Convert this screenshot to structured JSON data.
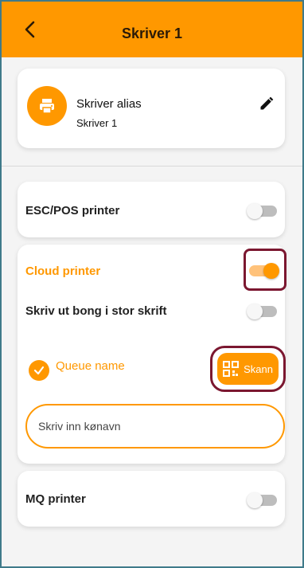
{
  "header": {
    "title": "Skriver 1",
    "back_icon": "chevron-left-icon"
  },
  "alias": {
    "icon": "printer-icon",
    "label": "Skriver alias",
    "value": "Skriver 1",
    "edit_icon": "pencil-icon"
  },
  "escpos": {
    "label": "ESC/POS printer",
    "enabled": false
  },
  "cloud": {
    "label": "Cloud printer",
    "enabled": true,
    "large_font": {
      "label": "Skriv ut bong i stor skrift",
      "enabled": false
    },
    "queue": {
      "label": "Queue name",
      "check_icon": "check-icon",
      "scan_label": "Skann",
      "scan_icon": "qr-code-icon",
      "placeholder": "Skriv inn kønavn",
      "value": ""
    }
  },
  "mq": {
    "label": "MQ printer",
    "enabled": false
  },
  "colors": {
    "accent": "#ff9800",
    "highlight": "#7b1730",
    "frame": "#3f7a8a"
  }
}
